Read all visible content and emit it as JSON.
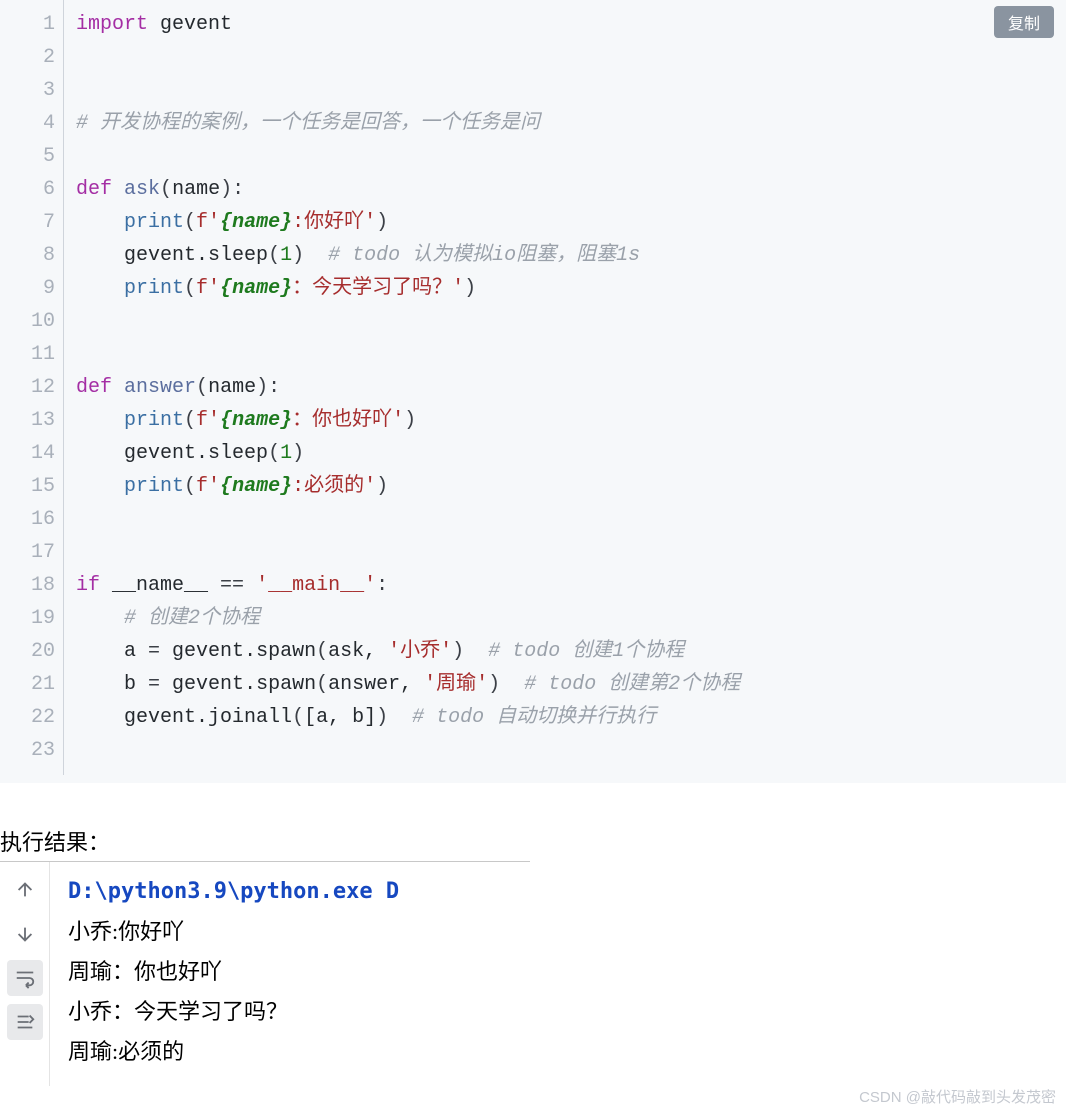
{
  "copy_button": "复制",
  "line_numbers": [
    "1",
    "2",
    "3",
    "4",
    "5",
    "6",
    "7",
    "8",
    "9",
    "10",
    "11",
    "12",
    "13",
    "14",
    "15",
    "16",
    "17",
    "18",
    "19",
    "20",
    "21",
    "22",
    "23"
  ],
  "code": {
    "l1": {
      "kw_import": "import",
      "mod": "gevent"
    },
    "l4": {
      "cmt": "# 开发协程的案例，一个任务是回答，一个任务是问"
    },
    "l6": {
      "kw_def": "def",
      "fn": "ask",
      "sig_open": "(",
      "param1": "name",
      "sig_close": "):"
    },
    "l7": {
      "builtin": "print",
      "op_open": "(",
      "fp": "f'",
      "fb1": "{name}",
      "mid": ":你好吖'",
      "op_close": ")"
    },
    "l8": {
      "obj": "gevent",
      "dot": ".",
      "meth": "sleep",
      "op_open": "(",
      "num": "1",
      "op_close": ")",
      "sp": "  ",
      "cmt": "# todo 认为模拟io阻塞，阻塞1s"
    },
    "l9": {
      "builtin": "print",
      "op_open": "(",
      "fp": "f'",
      "fb1": "{name}",
      "mid": "：今天学习了吗？'",
      "op_close": ")"
    },
    "l12": {
      "kw_def": "def",
      "fn": "answer",
      "sig_open": "(",
      "param1": "name",
      "sig_close": "):"
    },
    "l13": {
      "builtin": "print",
      "op_open": "(",
      "fp": "f'",
      "fb1": "{name}",
      "mid": "：你也好吖'",
      "op_close": ")"
    },
    "l14": {
      "obj": "gevent",
      "dot": ".",
      "meth": "sleep",
      "op_open": "(",
      "num": "1",
      "op_close": ")"
    },
    "l15": {
      "builtin": "print",
      "op_open": "(",
      "fp": "f'",
      "fb1": "{name}",
      "mid": ":必须的'",
      "op_close": ")"
    },
    "l18": {
      "kw_if": "if",
      "dunder": "__name__",
      "eq": " == ",
      "str": "'__main__'",
      "colon": ":"
    },
    "l19": {
      "cmt": "# 创建2个协程"
    },
    "l20": {
      "var": "a",
      "eq": " = ",
      "obj": "gevent",
      "dot": ".",
      "meth": "spawn",
      "op_open": "(",
      "arg1": "ask",
      "comma": ", ",
      "str": "'小乔'",
      "op_close": ")",
      "sp": "  ",
      "cmt": "# todo 创建1个协程"
    },
    "l21": {
      "var": "b",
      "eq": " = ",
      "obj": "gevent",
      "dot": ".",
      "meth": "spawn",
      "op_open": "(",
      "arg1": "answer",
      "comma": ", ",
      "str": "'周瑜'",
      "op_close": ")",
      "sp": "  ",
      "cmt": "# todo 创建第2个协程"
    },
    "l22": {
      "obj": "gevent",
      "dot": ".",
      "meth": "joinall",
      "op_open": "(",
      "list": "[a, b]",
      "op_close": ")",
      "sp": "  ",
      "cmt": "# todo 自动切换并行执行"
    }
  },
  "result_label": "执行结果：",
  "output": {
    "cmd": "D:\\python3.9\\python.exe D",
    "lines": [
      "小乔:你好吖",
      "周瑜：你也好吖",
      "小乔：今天学习了吗？",
      "周瑜:必须的"
    ]
  },
  "watermark": "CSDN @敲代码敲到头发茂密"
}
